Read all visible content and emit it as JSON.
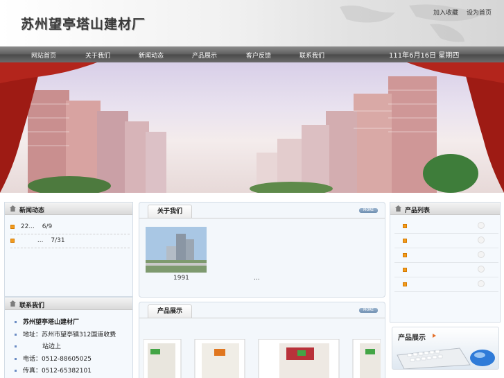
{
  "header": {
    "logo": "苏州望亭塔山建材厂",
    "links": [
      "加入收藏",
      "设为首页"
    ]
  },
  "nav": {
    "items": [
      "网站首页",
      "关于我们",
      "新闻动态",
      "产品展示",
      "客户反馈",
      "联系我们"
    ],
    "date": "111年6月16日 星期四"
  },
  "news": {
    "title": "新闻动态",
    "items": [
      {
        "text": "22...",
        "date": "6/9"
      },
      {
        "text": "...",
        "date": "7/31"
      }
    ]
  },
  "about": {
    "title": "关于我们",
    "more": "MORE",
    "caption": "1991",
    "ellipsis": "..."
  },
  "products_show": {
    "title": "产品展示",
    "more": "MORE"
  },
  "product_list": {
    "title": "产品列表",
    "count": 5
  },
  "product_promo": {
    "label": "产品展示"
  },
  "contact": {
    "title": "联系我们",
    "company": "苏州望亭塔山建材厂",
    "address_label": "地址：",
    "address": "苏州市望亭镇312国道收费",
    "address_cont": "站边上",
    "phone": "电话：0512-88605025",
    "fax": "传真：0512-65382101"
  },
  "colors": {
    "accent": "#f29b1d",
    "nav_bg": "#5e5e5e",
    "box_bg": "#f5f9fd"
  }
}
